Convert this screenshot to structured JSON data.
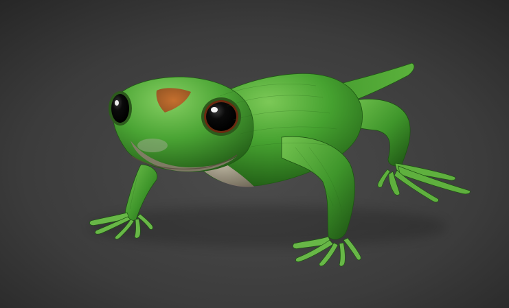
{
  "scene": {
    "subject": "",
    "colors": {
      "background_top": "#2f2f2f",
      "background_center": "#4a4a4a",
      "background_bottom": "#3a3a3a",
      "skin_light": "#6fbf4a",
      "skin_mid": "#3f9a2a",
      "skin_dark": "#1f5a14",
      "belly": "#b8a89a",
      "belly_shadow": "#8c7c70",
      "head_spot": "#c0642a",
      "eye": "#050505",
      "eye_rim": "#6a2a10",
      "eye_highlight": "#ffffff"
    }
  }
}
